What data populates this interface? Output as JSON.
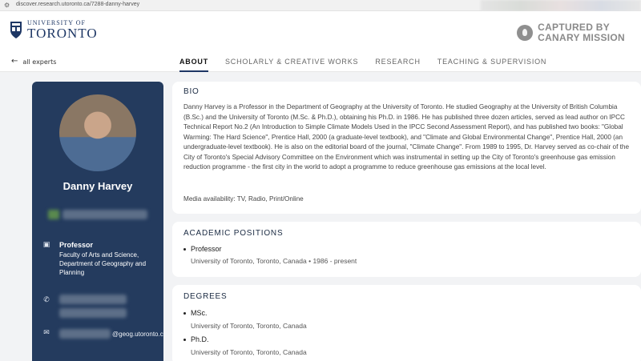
{
  "browser": {
    "url": "discover.research.utoronto.ca/7288-danny-harvey"
  },
  "header": {
    "logo_small": "UNIVERSITY OF",
    "logo_big": "TORONTO",
    "captured_line1": "CAPTURED BY",
    "captured_line2": "CANARY MISSION"
  },
  "nav": {
    "back_label": "all experts",
    "tabs": [
      {
        "label": "ABOUT"
      },
      {
        "label": "SCHOLARLY & CREATIVE WORKS"
      },
      {
        "label": "RESEARCH"
      },
      {
        "label": "TEACHING & SUPERVISION"
      }
    ]
  },
  "profile": {
    "name": "Danny Harvey",
    "position_title": "Professor",
    "position_desc": "Faculty of Arts and Science, Department of Geography and Planning",
    "email_visible": "@geog.utoronto.ca"
  },
  "bio": {
    "heading": "BIO",
    "text": "Danny Harvey is a Professor in the Department of Geography at the University of Toronto. He studied Geography at the University of British Columbia (B.Sc.) and the University of Toronto (M.Sc. & Ph.D.), obtaining his Ph.D. in 1986. He has published three dozen articles, served as lead author on IPCC Technical Report No.2 (An Introduction to Simple Climate Models Used in the IPCC Second Assessment Report), and has published two books: \"Global Warming: The Hard Science\", Prentice Hall, 2000 (a graduate-level textbook), and \"Climate and Global Environmental Change\", Prentice Hall, 2000 (an undergraduate-level textbook). He is also on the editorial board of the journal, \"Climate Change\". From 1989 to 1995, Dr. Harvey served as co-chair of the City of Toronto's Special Advisory Committee on the Environment which was instrumental in setting up the City of Toronto's greenhouse gas emission reduction programme - the first city in the world to adopt a programme to reduce greenhouse gas emissions at the local level.",
    "media": "Media availability: TV, Radio, Print/Online"
  },
  "academic": {
    "heading": "ACADEMIC POSITIONS",
    "items": [
      {
        "title": "Professor",
        "detail": "University of Toronto, Toronto, Canada  •  1986 - present"
      }
    ]
  },
  "degrees": {
    "heading": "DEGREES",
    "items": [
      {
        "title": "MSc.",
        "detail": "University of Toronto, Toronto, Canada"
      },
      {
        "title": "Ph.D.",
        "detail": "University of Toronto, Toronto, Canada"
      }
    ]
  },
  "colors": {
    "navy": "#243b5e",
    "uoft_blue": "#1e3765"
  }
}
